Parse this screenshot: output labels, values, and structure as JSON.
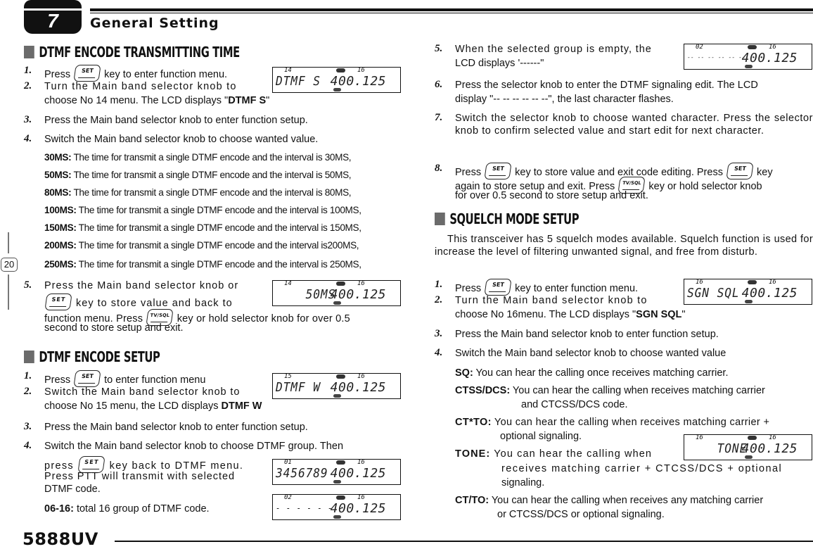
{
  "header": {
    "chapter_number": "7",
    "chapter_title": "General Setting"
  },
  "page_number": "20",
  "footer": {
    "model": "5888UV"
  },
  "keys": {
    "set": "SET",
    "tvsql": "TV/SQL"
  },
  "left": {
    "s1": {
      "title": "DTMF ENCODE TRANSMITTING TIME",
      "step1_pre": "Press",
      "step1_post": "key to enter function menu.",
      "step2_a": "Turn the Main band selector knob to",
      "step2_b": "choose No 14 menu. The LCD displays \"",
      "step2_bold": "DTMF S",
      "step2_end": "\"",
      "step3": "Press the Main band selector knob to enter function setup.",
      "step4": "Switch the Main band selector knob to choose wanted value.",
      "options": [
        {
          "key": "30MS:",
          "text": " The time for transmit a single DTMF encode and the interval is 30MS,"
        },
        {
          "key": "50MS:",
          "text": " The time for transmit a single DTMF encode and the interval is 50MS,"
        },
        {
          "key": "80MS:",
          "text": " The time for transmit a single DTMF encode and the interval is 80MS,"
        },
        {
          "key": "100MS:",
          "text": " The time for transmit a single DTMF encode and the interval is 100MS,"
        },
        {
          "key": "150MS:",
          "text": " The time for transmit a single DTMF encode and the interval is 150MS,"
        },
        {
          "key": "200MS:",
          "text": " The time for transmit a single DTMF encode and the interval is200MS,"
        },
        {
          "key": "250MS:",
          "text": " The time for transmit a single DTMF encode and the interval is 250MS,"
        }
      ],
      "step5_a": "Press the Main band selector knob or",
      "step5_b": "key to store value  and  back to",
      "step5_c_pre": "function menu. Press",
      "step5_c_post": "key or hold selector knob for over 0.5",
      "step5_d": "second to store setup and exit.",
      "lcd1": {
        "menu": "14",
        "ch": "16",
        "text": "DTMF S",
        "freq": "400.125"
      },
      "lcd2": {
        "menu": "14",
        "ch": "16",
        "text": "    50MS",
        "freq": "400.125"
      }
    },
    "s2": {
      "title": "DTMF ENCODE SETUP",
      "step1_pre": "Press",
      "step1_post": " to enter function menu",
      "step2_a": "Switch the Main band selector knob to",
      "step2_b": "choose No 15 menu, the LCD displays ",
      "step2_bold": "DTMF W",
      "step3": "Press the Main band selector knob to enter function setup.",
      "step4_a": "Switch the Main band selector knob to choose DTMF group. Then",
      "step4_b_pre": "press",
      "step4_b_post": "key back to DTMF menu.",
      "step4_c": "Press PTT will transmit with selected",
      "step4_d": "DTMF code.",
      "note_key": "06-16:",
      "note_text": "  total 16 group of DTMF code.",
      "lcd1": {
        "menu": "15",
        "ch": "16",
        "text": "DTMF W",
        "freq": "400.125"
      },
      "lcd2": {
        "menu": "01",
        "ch": "16",
        "text": "3456789",
        "freq": "400.125"
      },
      "lcd3": {
        "menu": "02",
        "ch": "16",
        "text": "- - - - - - -",
        "freq": "400.125"
      }
    }
  },
  "right": {
    "step5_a": "When the selected group is empty, the",
    "step5_b": "LCD displays '------\"",
    "step6_a": "Press the selector knob to enter the DTMF signaling edit. The LCD",
    "step6_b": "display \"-- -- -- -- -- --\", the last character flashes.",
    "step7": "Switch the selector knob to choose wanted character. Press the selector knob to confirm selected value and start edit for next character.",
    "step8_a_pre": "Press",
    "step8_a_mid": "key to store value and exit code editing. Press",
    "step8_a_post": "key",
    "step8_b_pre": "again to store setup and exit. Press",
    "step8_b_post": "key or hold selector knob",
    "step8_c": "for over 0.5 second to store setup and exit.",
    "lcd0": {
      "menu": "02",
      "ch": "16",
      "text": "-- -- -- -- -- --",
      "freq": "400.125"
    },
    "s3": {
      "title": "SQUELCH MODE SETUP",
      "intro": "This transceiver has 5 squelch modes available. Squelch function is used for increase the level of filtering unwanted signal, and free from disturb.",
      "step1_pre": "Press",
      "step1_post": "key to enter function menu.",
      "step2_a": "Turn the Main band selector knob to",
      "step2_b": "choose No 16menu. The LCD displays \"",
      "step2_bold": "SGN SQL",
      "step2_end": "\"",
      "step3": "Press the Main band selector knob to enter function setup.",
      "step4": "Switch the Main band selector knob to choose wanted value",
      "sq_key": "SQ:",
      "sq_text": " You can hear the calling once receives matching carrier.",
      "ctss_key": "CTSS/DCS:",
      "ctss_text_a": " You can hear the calling when receives matching carrier",
      "ctss_text_b": "and CTCSS/DCS code.",
      "ctto_key": "CT*TO:",
      "ctto_text_a": " You can hear the calling when receives matching carrier +",
      "ctto_text_b": "optional signaling.",
      "tone_key": "TONE:",
      "tone_text_a": " You can hear the calling when",
      "tone_text_b": "receives matching carrier + CTCSS/DCS + optional",
      "tone_text_c": "signaling.",
      "ct2_key": "CT/TO:",
      "ct2_text_a": " You can hear the calling when receives any matching carrier",
      "ct2_text_b": "or CTCSS/DCS or  optional signaling.",
      "lcd1": {
        "menu": "16",
        "ch": "16",
        "text": "SGN SQL",
        "freq": "400.125"
      },
      "lcd2": {
        "menu": "16",
        "ch": "16",
        "text": "    TONE",
        "freq": "400.125"
      }
    }
  }
}
